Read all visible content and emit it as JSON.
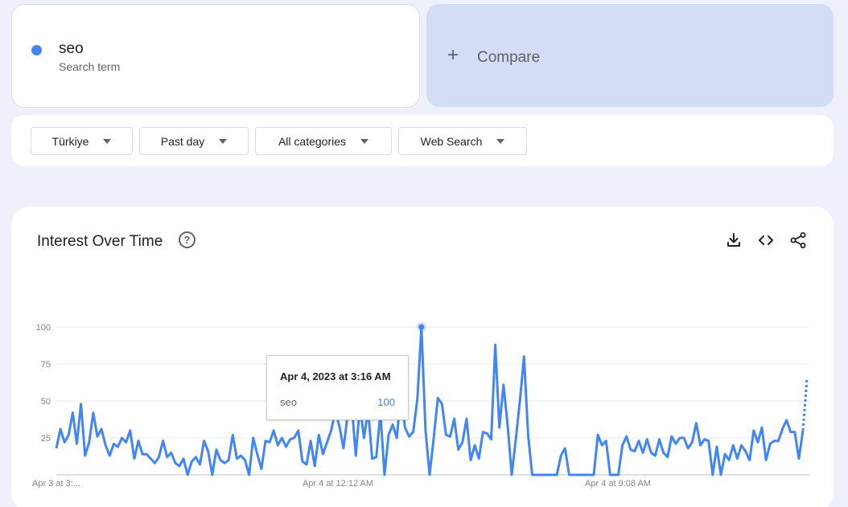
{
  "search_term": {
    "name": "seo",
    "subtitle": "Search term",
    "color": "#4285f4"
  },
  "compare": {
    "label": "Compare",
    "icon": "plus-icon"
  },
  "filters": [
    {
      "label": "Türkiye"
    },
    {
      "label": "Past day"
    },
    {
      "label": "All categories"
    },
    {
      "label": "Web Search"
    }
  ],
  "chart_panel": {
    "title": "Interest Over Time",
    "help_icon": "help-circle-icon",
    "toolbar": [
      "download-icon",
      "embed-code-icon",
      "share-icon"
    ]
  },
  "tooltip": {
    "date": "Apr 4, 2023 at 3:16 AM",
    "term": "seo",
    "value": "100"
  },
  "chart_data": {
    "type": "line",
    "ylim": [
      0,
      100
    ],
    "y_ticks": [
      "100",
      "75",
      "50",
      "25"
    ],
    "x_tick_labels": [
      "Apr 3 at 3:...",
      "Apr 4 at 12:12 AM",
      "Apr 4 at 9:08 AM"
    ],
    "grid": true,
    "series": [
      {
        "color": "#4285f4",
        "values": [
          18,
          31,
          22,
          27,
          42,
          21,
          48,
          13,
          22,
          42,
          26,
          31,
          20,
          13,
          21,
          19,
          25,
          22,
          30,
          11,
          23,
          14,
          14,
          11,
          8,
          12,
          23,
          12,
          15,
          8,
          6,
          11,
          0,
          9,
          12,
          7,
          23,
          16,
          0,
          17,
          10,
          8,
          10,
          27,
          11,
          13,
          10,
          0,
          25,
          14,
          4,
          23,
          22,
          30,
          20,
          25,
          19,
          24,
          25,
          30,
          9,
          7,
          23,
          6,
          27,
          14,
          22,
          30,
          43,
          33,
          18,
          40,
          48,
          13,
          47,
          25,
          44,
          11,
          12,
          42,
          0,
          27,
          34,
          25,
          55,
          32,
          26,
          29,
          51,
          100,
          30,
          0,
          25,
          52,
          48,
          27,
          26,
          38,
          17,
          22,
          38,
          10,
          20,
          11,
          29,
          28,
          24,
          88,
          32,
          61,
          34,
          0,
          24,
          50,
          80,
          27,
          0,
          0,
          0,
          0,
          0,
          0,
          0,
          13,
          18,
          0,
          0,
          0,
          0,
          0,
          0,
          0,
          27,
          20,
          23,
          0,
          0,
          0,
          20,
          26,
          17,
          16,
          23,
          15,
          24,
          15,
          13,
          24,
          15,
          12,
          26,
          21,
          25,
          25,
          18,
          22,
          35,
          20,
          24,
          23,
          0,
          19,
          0,
          14,
          10,
          20,
          11,
          20,
          16,
          10,
          30,
          22,
          32,
          10,
          21,
          23,
          23,
          31,
          37,
          29,
          29,
          11,
          30
        ]
      }
    ],
    "partial_tail": [
      30,
      65
    ],
    "highlight_value": 100
  }
}
